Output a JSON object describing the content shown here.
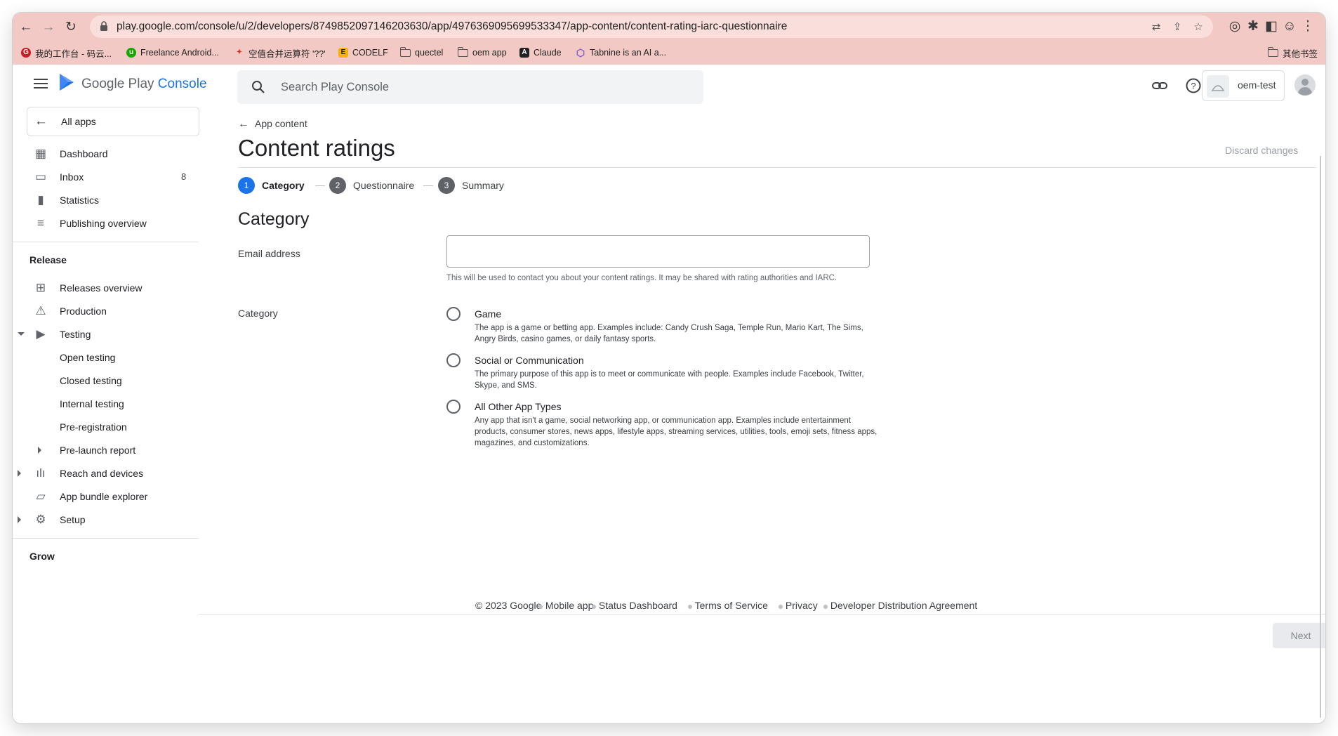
{
  "browser": {
    "url": "play.google.com/console/u/2/developers/8749852097146203630/app/4976369095699533347/app-content/content-rating-iarc-questionnaire",
    "bookmarks": [
      {
        "label": "我的工作台 - 码云...",
        "icon": "gitee-icon",
        "color": "#c71d23"
      },
      {
        "label": "Freelance Android...",
        "icon": "upwork-icon",
        "color": "#14a800"
      },
      {
        "label": "空值合并运算符 '??'",
        "icon": "torch-icon",
        "color": "#d93025"
      },
      {
        "label": "CODELF",
        "icon": "codelf-icon",
        "color": "#f5b400"
      },
      {
        "label": "quectel",
        "icon": "folder-icon",
        "color": "#555555"
      },
      {
        "label": "oem app",
        "icon": "folder-icon",
        "color": "#555555"
      },
      {
        "label": "Claude",
        "icon": "anthropic-icon",
        "color": "#222222"
      },
      {
        "label": "Tabnine is an AI a...",
        "icon": "tabnine-icon",
        "color": "#7b5cd6"
      }
    ],
    "other_bookmarks": "其他书签"
  },
  "header": {
    "logo_google_play": "Google Play",
    "logo_console": "Console",
    "search_placeholder": "Search Play Console",
    "account_name": "oem-test"
  },
  "sidebar": {
    "all_apps": "All apps",
    "items": [
      {
        "label": "Dashboard",
        "icon": "dashboard-icon"
      },
      {
        "label": "Inbox",
        "icon": "inbox-icon",
        "count": "8"
      },
      {
        "label": "Statistics",
        "icon": "statistics-icon"
      },
      {
        "label": "Publishing overview",
        "icon": "publishing-icon"
      }
    ],
    "release_header": "Release",
    "release_items": [
      {
        "label": "Releases overview",
        "icon": "releases-icon"
      },
      {
        "label": "Production",
        "icon": "production-icon"
      },
      {
        "label": "Testing",
        "icon": "testing-icon"
      },
      {
        "label": "Open testing"
      },
      {
        "label": "Closed testing"
      },
      {
        "label": "Internal testing"
      },
      {
        "label": "Pre-registration"
      },
      {
        "label": "Pre-launch report"
      },
      {
        "label": "Reach and devices",
        "icon": "reach-icon"
      },
      {
        "label": "App bundle explorer",
        "icon": "bundle-icon"
      },
      {
        "label": "Setup",
        "icon": "setup-icon"
      }
    ],
    "grow_header": "Grow"
  },
  "main": {
    "back_link": "App content",
    "title": "Content ratings",
    "discard": "Discard changes",
    "steps": [
      {
        "num": "1",
        "label": "Category",
        "active": true
      },
      {
        "num": "2",
        "label": "Questionnaire",
        "active": false
      },
      {
        "num": "3",
        "label": "Summary",
        "active": false
      }
    ],
    "section_title": "Category",
    "email_label": "Email address",
    "email_value": "",
    "email_help": "This will be used to contact you about your content ratings. It may be shared with rating authorities and IARC.",
    "category_label": "Category",
    "options": [
      {
        "title": "Game",
        "desc": "The app is a game or betting app. Examples include: Candy Crush Saga, Temple Run, Mario Kart, The Sims, Angry Birds, casino games, or daily fantasy sports."
      },
      {
        "title": "Social or Communication",
        "desc": "The primary purpose of this app is to meet or communicate with people. Examples include Facebook, Twitter, Skype, and SMS."
      },
      {
        "title": "All Other App Types",
        "desc": "Any app that isn't a game, social networking app, or communication app. Examples include entertainment products, consumer stores, news apps, lifestyle apps, streaming services, utilities, tools, emoji sets, fitness apps, magazines, and customizations."
      }
    ]
  },
  "footer": {
    "copyright": "© 2023 Google",
    "links": [
      "Mobile app",
      "Status Dashboard",
      "Terms of Service",
      "Privacy",
      "Developer Distribution Agreement"
    ]
  },
  "bottom": {
    "next": "Next"
  },
  "colors": {
    "accent": "#1a73e8",
    "step_inactive": "#5f6368",
    "chrome": "#f2c9c5"
  }
}
